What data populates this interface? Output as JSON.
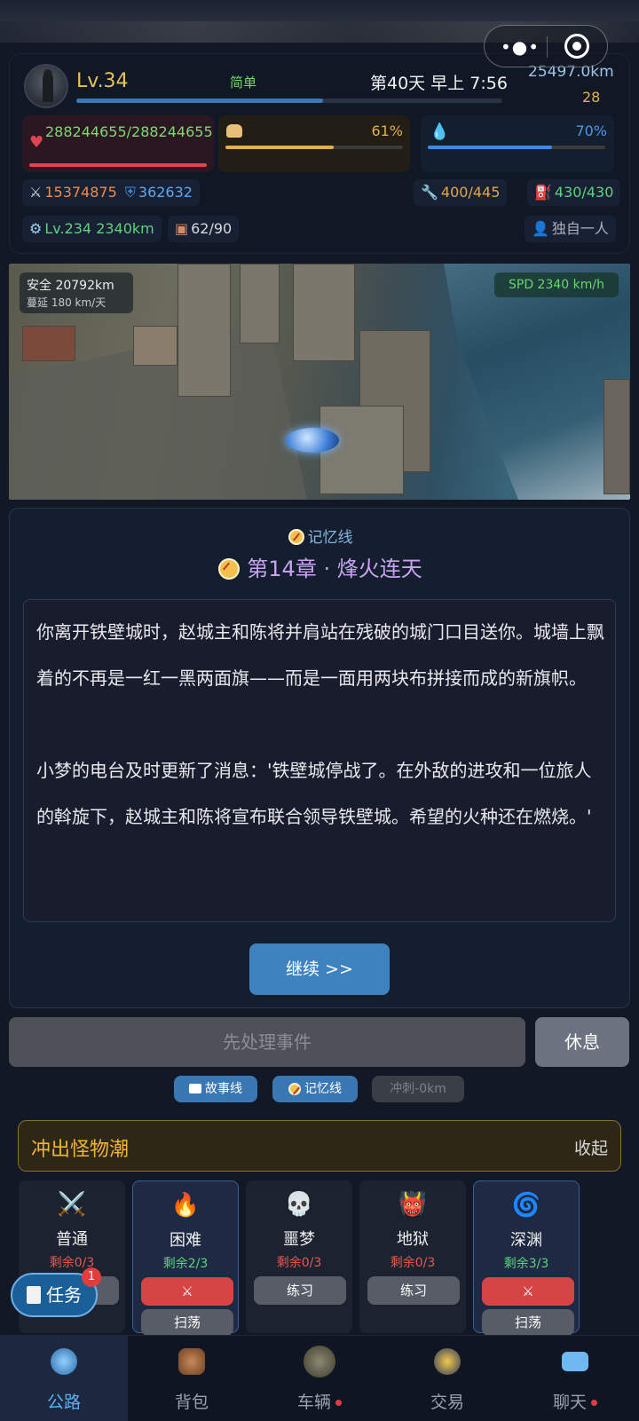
{
  "status": {
    "level": "Lv.34",
    "difficulty": "简单",
    "day_time": "第40天 早上 7:56",
    "distance": "25497.0km",
    "coins": "28",
    "xp_fraction": 0.58,
    "hp": "288244655/288244655",
    "food_pct": "61%",
    "food_fraction": 0.61,
    "water_pct": "70%",
    "water_fraction": 0.7,
    "attack": "15374875",
    "defense": "362632",
    "tool": "400/445",
    "fuel": "430/430",
    "engine": "Lv.234 2340km",
    "cargo": "62/90",
    "companion": "独自一人"
  },
  "scene": {
    "safe": "安全 20792km",
    "spread": "蔓延 180 km/天",
    "speed": "SPD 2340 km/h"
  },
  "story": {
    "tag": "记忆线",
    "chapter": "第14章 · 烽火连天",
    "text": "你离开铁壁城时，赵城主和陈将并肩站在残破的城门口目送你。城墙上飘着的不再是一红一黑两面旗——而是一面用两块布拼接而成的新旗帜。\n\n小梦的电台及时更新了消息：'铁壁城停战了。在外敌的进攻和一位旅人的斡旋下，赵城主和陈将宣布联合领导铁壁城。希望的火种还在燃烧。'",
    "continue": "继续 >>"
  },
  "actions": {
    "handle": "先处理事件",
    "rest": "休息",
    "story_line": "故事线",
    "memory_line": "记忆线",
    "dash": "冲刺-0km"
  },
  "monster_wave": {
    "title": "冲出怪物潮",
    "collapse": "收起",
    "levels": [
      {
        "name": "普通",
        "remain": "剩余0/3",
        "practice": "练习"
      },
      {
        "name": "困难",
        "remain": "剩余2/3",
        "fight": "⚔",
        "sweep": "扫荡"
      },
      {
        "name": "噩梦",
        "remain": "剩余0/3",
        "practice": "练习"
      },
      {
        "name": "地狱",
        "remain": "剩余0/3",
        "practice": "练习"
      },
      {
        "name": "深渊",
        "remain": "剩余3/3",
        "fight": "⚔",
        "sweep": "扫荡"
      }
    ]
  },
  "task": {
    "label": "任务",
    "badge": "1"
  },
  "nav": [
    {
      "label": "公路"
    },
    {
      "label": "背包"
    },
    {
      "label": "车辆"
    },
    {
      "label": "交易"
    },
    {
      "label": "聊天"
    }
  ]
}
